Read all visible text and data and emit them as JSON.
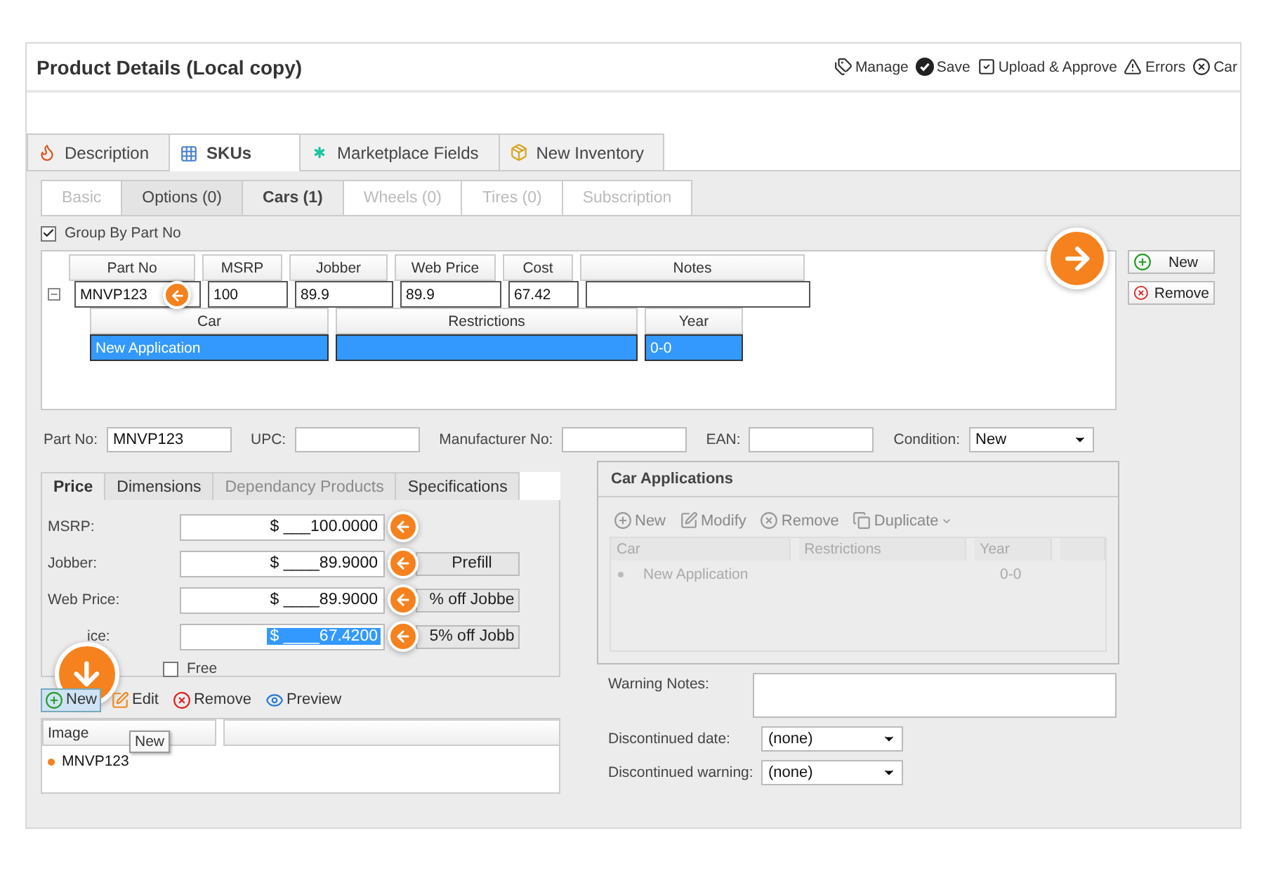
{
  "window": {
    "title": "Product Details (Local copy)"
  },
  "actions": [
    {
      "label": "Manage",
      "kind": "tag"
    },
    {
      "label": "Save",
      "kind": "save"
    },
    {
      "label": "Upload & Approve",
      "kind": "approve"
    },
    {
      "label": "Errors",
      "kind": "warning"
    },
    {
      "label": "Car",
      "kind": "cancel"
    }
  ],
  "main_tabs": [
    {
      "label": "Description",
      "kind": "description",
      "selected": false
    },
    {
      "label": "SKUs",
      "kind": "grid",
      "selected": true
    },
    {
      "label": "Marketplace Fields",
      "kind": "asterisk",
      "selected": false
    },
    {
      "label": "New Inventory",
      "kind": "box",
      "selected": false
    }
  ],
  "sub_tabs": [
    {
      "label": "Basic",
      "selected": false,
      "disabled": true
    },
    {
      "label": "Options (0)",
      "selected": false,
      "disabled": false
    },
    {
      "label": "Cars (1)",
      "selected": true,
      "disabled": false
    },
    {
      "label": "Wheels (0)",
      "selected": false,
      "disabled": true
    },
    {
      "label": "Tires (0)",
      "selected": false,
      "disabled": true
    },
    {
      "label": "Subscription",
      "selected": false,
      "disabled": true
    }
  ],
  "group_by": {
    "label": "Group By Part No",
    "checked": true
  },
  "sku_grid": {
    "callout": true,
    "columns": [
      "Part No",
      "MSRP",
      "Jobber",
      "Web Price",
      "Cost",
      "Notes"
    ],
    "rows": [
      {
        "part_no": "MNVP123",
        "msrp": "100",
        "jobber": "89.9",
        "web_price": "89.9",
        "cost": "67.42",
        "expanded": true,
        "callout": true,
        "child_columns": [
          "Car",
          "Restrictions",
          "Year"
        ],
        "children": [
          {
            "car": "New Application",
            "year": "0-0",
            "selected": true
          }
        ]
      }
    ]
  },
  "grid_buttons": [
    {
      "label": "New",
      "kind": "add"
    },
    {
      "label": "Remove",
      "kind": "remove"
    }
  ],
  "fields": [
    {
      "label": "Part No:",
      "value": "MNVP123",
      "kind": "text"
    },
    {
      "label": "UPC:",
      "kind": "text"
    },
    {
      "label": "Manufacturer No:",
      "kind": "text"
    },
    {
      "label": "EAN:",
      "kind": "text"
    },
    {
      "label": "Condition:",
      "value": "New",
      "kind": "select"
    }
  ],
  "price_tabs": [
    {
      "label": "Price",
      "selected": true,
      "disabled": false
    },
    {
      "label": "Dimensions",
      "selected": false,
      "disabled": false
    },
    {
      "label": "Dependancy Products",
      "selected": false,
      "disabled": true
    },
    {
      "label": "Specifications",
      "selected": false,
      "disabled": false
    }
  ],
  "prices": [
    {
      "label": "MSRP:",
      "value": "$ ___100.0000",
      "selected": false,
      "callout": true
    },
    {
      "label": "Jobber:",
      "value": "$ ____89.9000",
      "selected": false,
      "callout": true,
      "button": "Prefill"
    },
    {
      "label": "Web Price:",
      "value": "$ ____89.9000",
      "selected": false,
      "callout": true,
      "button": "% off Jobbe"
    },
    {
      "label": "ice:",
      "value": "$ ____67.4200",
      "selected": true,
      "callout": true,
      "button": "5% off Jobb"
    }
  ],
  "free": {
    "label": "Free",
    "checked": false
  },
  "image_toolbar": {
    "callout": true,
    "items": [
      {
        "label": "New",
        "kind": "add",
        "selected": true
      },
      {
        "label": "Edit",
        "kind": "edit",
        "selected": false
      },
      {
        "label": "Remove",
        "kind": "remove",
        "selected": false
      },
      {
        "label": "Preview",
        "kind": "preview",
        "selected": false
      }
    ]
  },
  "image_grid": {
    "columns": [
      "Image"
    ],
    "rows": [
      {
        "text": "MNVP123"
      }
    ]
  },
  "tooltip": "New",
  "car_applications": {
    "title": "Car Applications",
    "disabled": true,
    "toolbar": [
      {
        "label": "New",
        "kind": "add"
      },
      {
        "label": "Modify",
        "kind": "edit"
      },
      {
        "label": "Remove",
        "kind": "remove"
      },
      {
        "label": "Duplicate",
        "kind": "duplicate"
      }
    ],
    "columns": [
      "Car",
      "Restrictions",
      "Year"
    ],
    "rows": [
      {
        "car": "New Application",
        "year": "0-0"
      }
    ]
  },
  "warning_notes": {
    "label": "Warning Notes:"
  },
  "discontinued": [
    {
      "label": "Discontinued date:",
      "value": "(none)"
    },
    {
      "label": "Discontinued warning:",
      "value": "(none)"
    }
  ]
}
